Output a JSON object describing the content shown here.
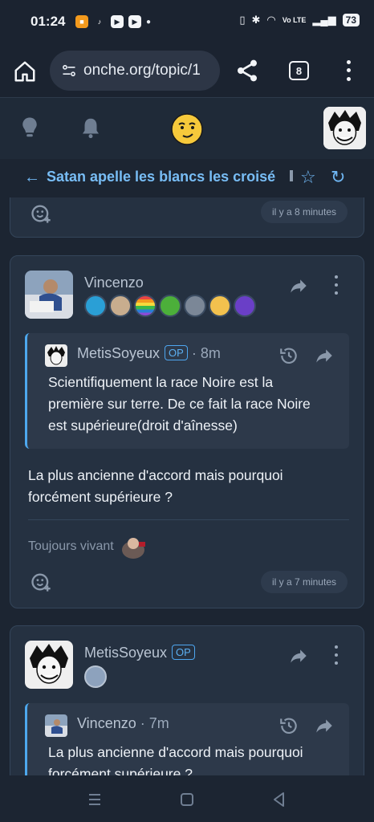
{
  "status": {
    "time": "01:24",
    "battery": "73",
    "network": "Vo LTE"
  },
  "browser": {
    "url": "onche.org/topic/1",
    "tab_count": "8"
  },
  "topic": {
    "title": "Satan apelle les blancs les croisé"
  },
  "prev_card": {
    "time": "il y a 8 minutes"
  },
  "post1": {
    "author": "Vincenzo",
    "quote": {
      "author": "MetisSoyeux",
      "op_label": "OP",
      "age": "· 8m",
      "text": "Scientifiquement la race Noire est la première sur terre. De ce fait la race Noire est supérieure(droit d'aînesse)"
    },
    "text": "La plus ancienne d'accord mais pourquoi forcément supérieure ?",
    "signature": "Toujours vivant",
    "time": "il y a 7 minutes"
  },
  "post2": {
    "author": "MetisSoyeux",
    "op_label": "OP",
    "quote": {
      "author": "Vincenzo",
      "age": "· 7m",
      "text": "La plus ancienne d'accord mais pourquoi forcément supérieure ?"
    }
  },
  "colors": {
    "accent": "#4da8ee",
    "background": "#1c2532",
    "card": "#253141"
  }
}
